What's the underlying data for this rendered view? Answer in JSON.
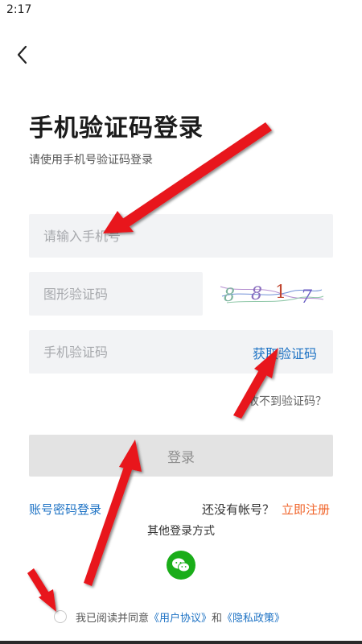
{
  "status_bar": {
    "time": "2:17"
  },
  "page": {
    "title": "手机验证码登录",
    "subtitle": "请使用手机号验证码登录"
  },
  "form": {
    "phone_placeholder": "请输入手机号",
    "captcha_placeholder": "图形验证码",
    "captcha_text": "8817",
    "sms_placeholder": "手机验证码",
    "get_code_label": "获取验证码",
    "no_code_label": "收不到验证码？",
    "login_label": "登录"
  },
  "links": {
    "password_login": "账号密码登录",
    "no_account": "还没有帐号？",
    "register": "立即注册",
    "other_login": "其他登录方式"
  },
  "agreement": {
    "prefix": "我已阅读并同意",
    "user_agreement": "《用户协议》",
    "and": "和",
    "privacy_policy": "《隐私政策》"
  },
  "colors": {
    "accent_blue": "#1d72c4",
    "register_orange": "#f0642a",
    "wechat_green": "#1aad19",
    "annotation_red": "#e8141b"
  },
  "icons": {
    "back": "chevron-left-icon",
    "wechat": "wechat-icon"
  }
}
